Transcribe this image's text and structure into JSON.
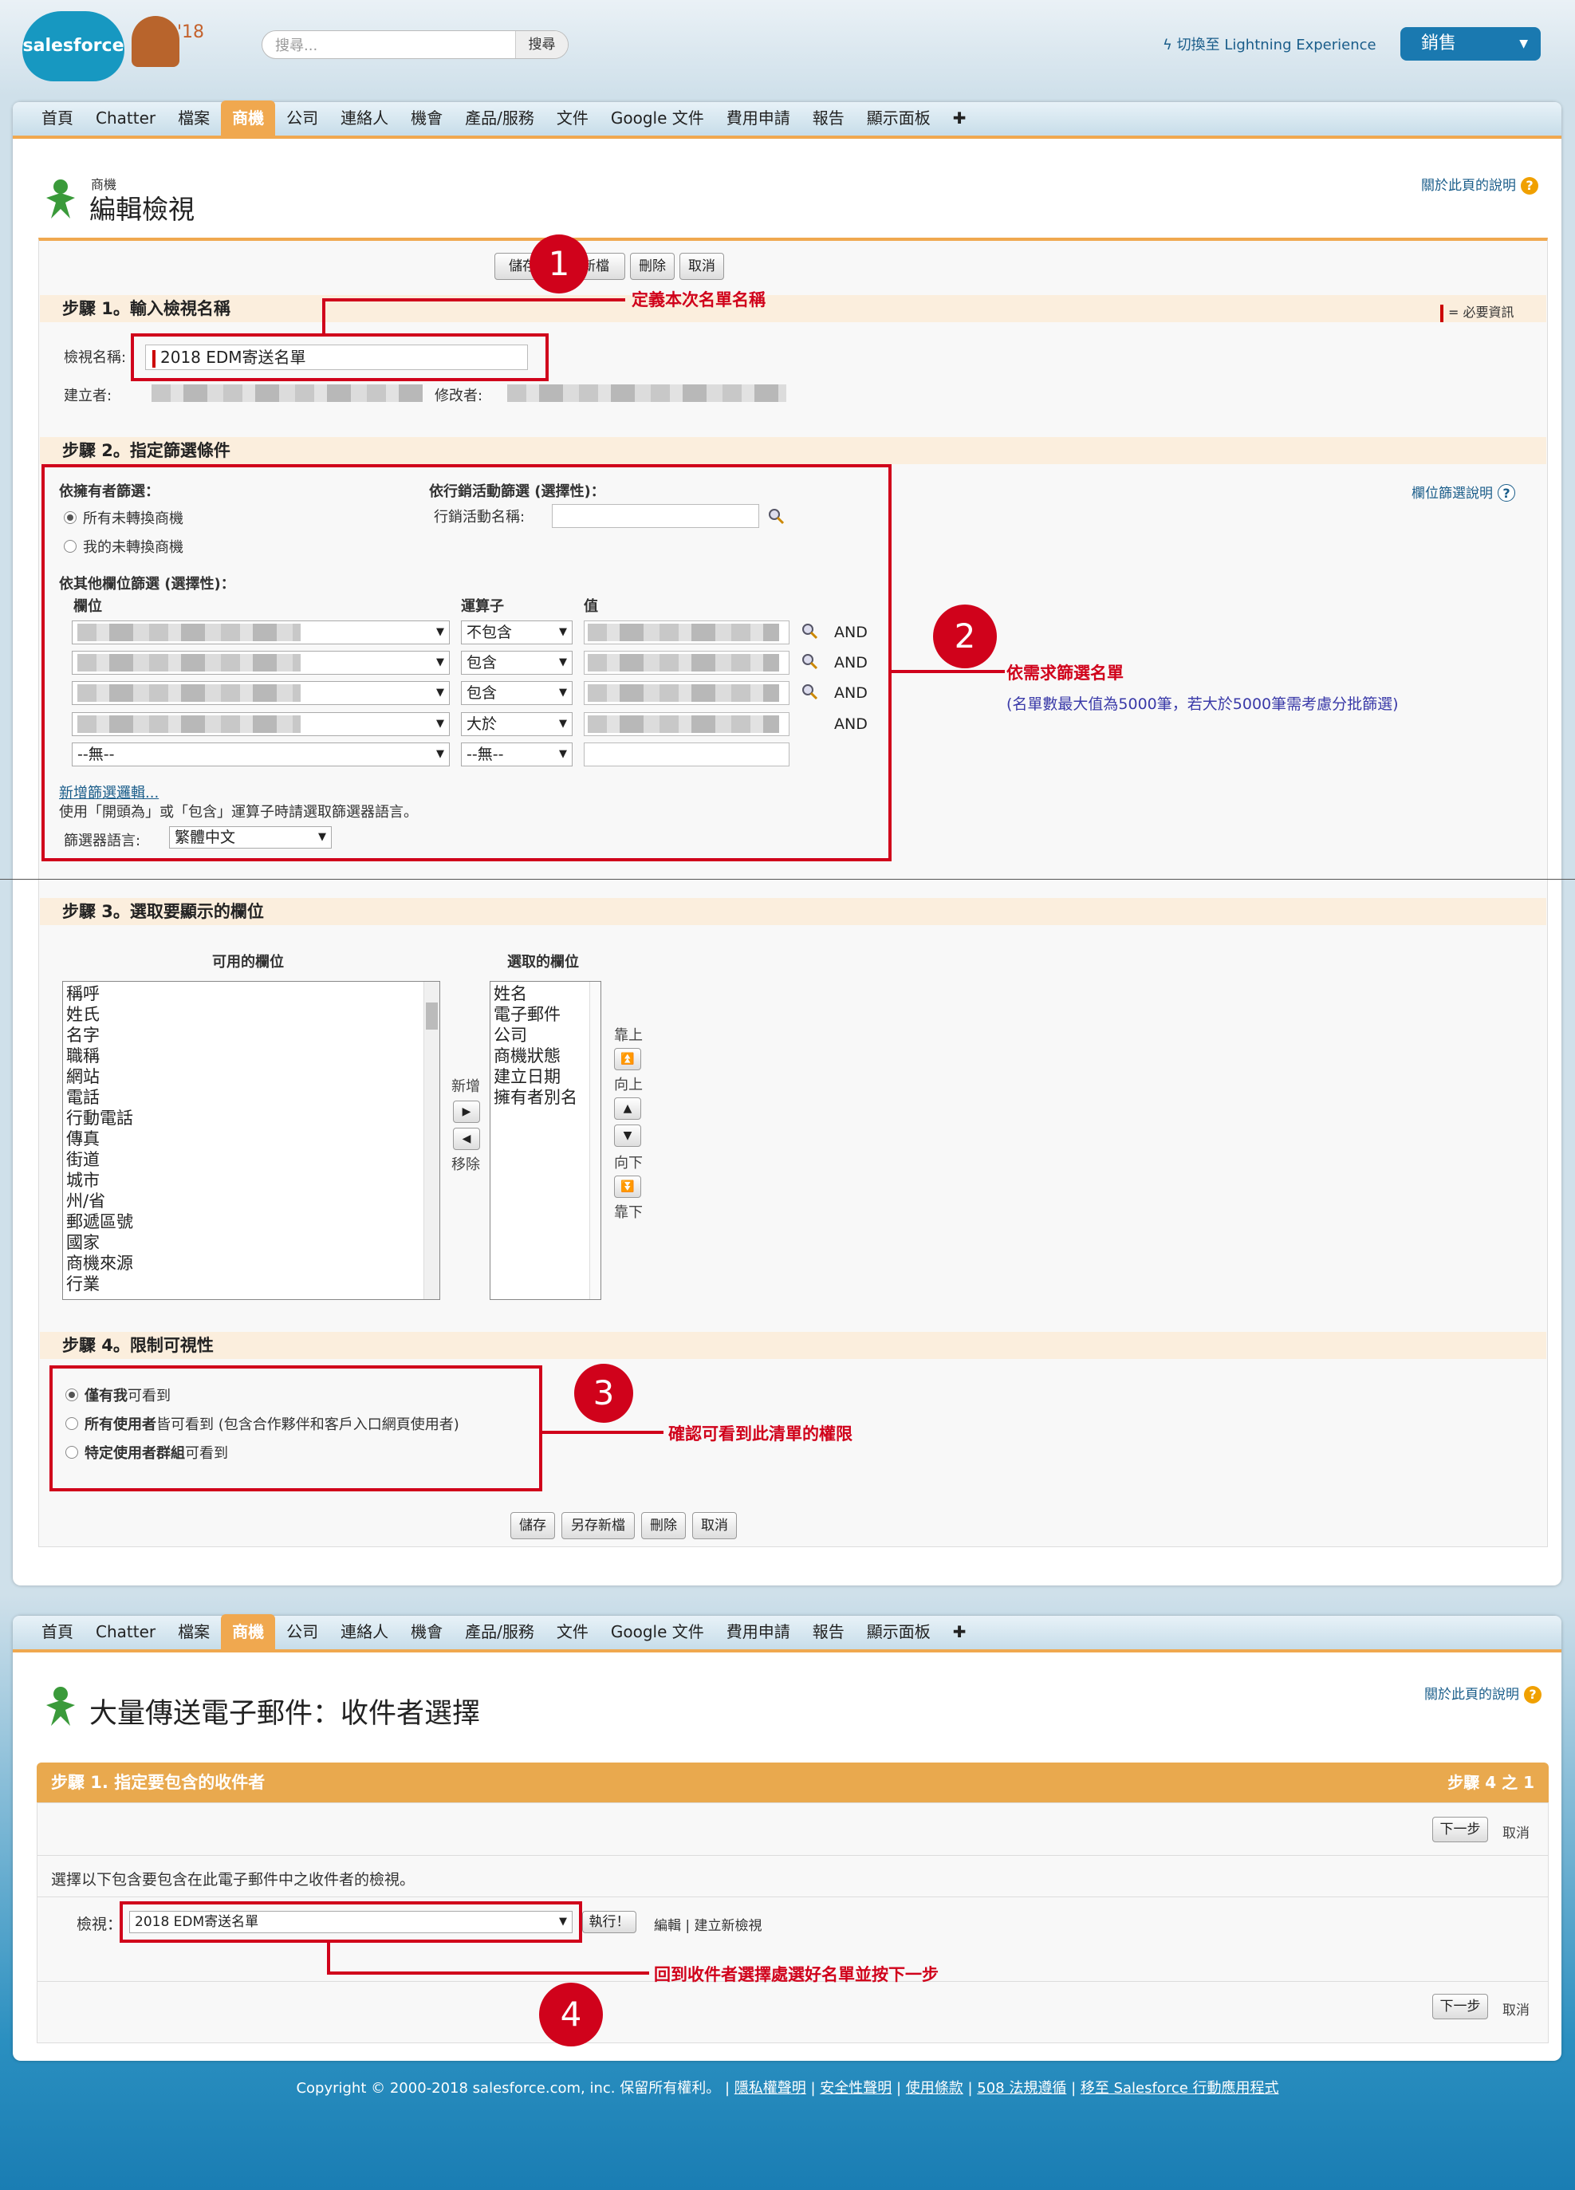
{
  "header": {
    "logo_text": "salesforce",
    "logo_badge": "'18",
    "search_placeholder": "搜尋...",
    "search_button": "搜尋",
    "switch_link": "切換至 Lightning Experience",
    "app_selector": "銷售"
  },
  "tabs": [
    "首頁",
    "Chatter",
    "檔案",
    "商機",
    "公司",
    "連絡人",
    "機會",
    "產品/服務",
    "文件",
    "Google 文件",
    "費用申請",
    "報告",
    "顯示面板",
    "✚"
  ],
  "active_tab": "商機",
  "edit_view": {
    "object_label": "商機",
    "page_title": "編輯檢視",
    "help_link": "關於此頁的說明",
    "buttons": {
      "save": "儲存",
      "save_as": "另存新檔",
      "delete": "刪除",
      "cancel": "取消"
    },
    "top_buttons": {
      "save": "儲存",
      "save_as_partial": "新檔",
      "delete": "刪除",
      "cancel": "取消"
    },
    "required_legend": "= 必要資訊",
    "step1": {
      "title": "步驟 1。輸入檢視名稱",
      "name_label": "檢視名稱:",
      "name_value": "2018 EDM寄送名單",
      "created_by_label": "建立者:",
      "modified_by_label": "修改者:"
    },
    "step2": {
      "title": "步驟 2。指定篩選條件",
      "owner_filter_label": "依擁有者篩選：",
      "owner_options": [
        "所有未轉換商機",
        "我的未轉換商機"
      ],
      "campaign_filter_label": "依行銷活動篩選 (選擇性)：",
      "campaign_name_label": "行銷活動名稱:",
      "other_filter_label": "依其他欄位篩選 (選擇性)：",
      "col_field": "欄位",
      "col_operator": "運算子",
      "col_value": "值",
      "rows": [
        {
          "operator": "不包含",
          "conj": "AND"
        },
        {
          "operator": "包含",
          "conj": "AND"
        },
        {
          "operator": "包含",
          "conj": "AND"
        },
        {
          "operator": "大於",
          "conj": "AND"
        },
        {
          "field": "--無--",
          "operator": "--無--",
          "conj": ""
        }
      ],
      "add_logic": "新增篩選邏輯...",
      "note": "使用「開頭為」或「包含」運算子時請選取篩選器語言。",
      "lang_label": "篩選器語言:",
      "lang_value": "繁體中文",
      "field_filter_help": "欄位篩選說明"
    },
    "step3": {
      "title": "步驟 3。選取要顯示的欄位",
      "available_label": "可用的欄位",
      "selected_label": "選取的欄位",
      "available": [
        "稱呼",
        "姓氏",
        "名字",
        "職稱",
        "網站",
        "電話",
        "行動電話",
        "傳真",
        "街道",
        "城市",
        "州/省",
        "郵遞區號",
        "國家",
        "商機來源",
        "行業"
      ],
      "selected": [
        "姓名",
        "電子郵件",
        "公司",
        "商機狀態",
        "建立日期",
        "擁有者別名"
      ],
      "add": "新增",
      "remove": "移除",
      "top": "靠上",
      "up": "向上",
      "down": "向下",
      "bottom": "靠下"
    },
    "step4": {
      "title": "步驟 4。限制可視性",
      "options": [
        {
          "bold": "僅有我",
          "rest": "可看到"
        },
        {
          "bold": "所有使用者",
          "rest": "皆可看到 (包含合作夥伴和客戶入口網頁使用者)"
        },
        {
          "bold": "特定使用者群組",
          "rest": "可看到"
        }
      ]
    }
  },
  "annotations": {
    "n1": "1",
    "t1": "定義本次名單名稱",
    "n2": "2",
    "t2": "依需求篩選名單",
    "t2b": "(名單數最大值為5000筆，若大於5000筆需考慮分批篩選)",
    "n3": "3",
    "t3": "確認可看到此清單的權限",
    "n4": "4",
    "t4": "回到收件者選擇處選好名單並按下一步"
  },
  "mass_email": {
    "page_title": "大量傳送電子郵件：收件者選擇",
    "help_link": "關於此頁的說明",
    "step_header": "步驟 1. 指定要包含的收件者",
    "step_count": "步驟 4 之 1",
    "next": "下一步",
    "cancel": "取消",
    "instruction": "選擇以下包含要包含在此電子郵件中之收件者的檢視。",
    "view_label": "檢視：",
    "view_value": "2018 EDM寄送名單",
    "go": "執行！",
    "edit": "編輯",
    "new_view": "建立新檢視"
  },
  "footer": {
    "copyright": "Copyright © 2000-2018 salesforce.com, inc. 保留所有權利。",
    "links": [
      "隱私權聲明",
      "安全性聲明",
      "使用條款",
      "508 法規遵循",
      "移至 Salesforce 行動應用程式"
    ]
  },
  "colors": {
    "accent": "#f0a84f",
    "brand": "#1798c1",
    "annotation": "#d0021b"
  }
}
